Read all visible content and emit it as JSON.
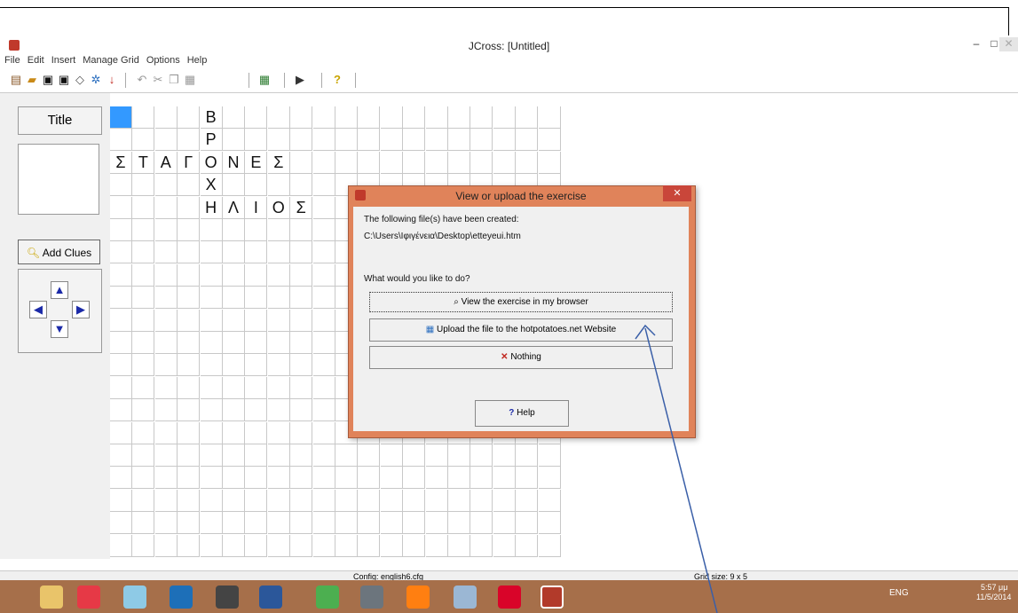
{
  "window": {
    "title": "JCross: [Untitled]",
    "minimize": "–",
    "maximize": "□",
    "close": "✕"
  },
  "menu": [
    "File",
    "Edit",
    "Insert",
    "Manage Grid",
    "Options",
    "Help"
  ],
  "toolbar_icons": [
    "new-icon",
    "open-icon",
    "save-icon",
    "save-as-icon",
    "eraser-icon",
    "web-page-icon",
    "down-arrow-icon",
    "undo-icon",
    "cut-icon",
    "copy-icon",
    "paste-icon",
    "grid-icon",
    "exercise-icon",
    "help-icon"
  ],
  "left_panel": {
    "title_button": "Title",
    "add_clues_button": "Add Clues"
  },
  "grid": {
    "rows": [
      [
        "",
        "",
        "",
        "",
        "Β"
      ],
      [
        "",
        "",
        "",
        "",
        "Ρ"
      ],
      [
        "Σ",
        "Τ",
        "Α",
        "Γ",
        "Ο",
        "Ν",
        "Ε",
        "Σ"
      ],
      [
        "",
        "",
        "",
        "",
        "Χ"
      ],
      [
        "",
        "",
        "",
        "",
        "Η",
        "Λ",
        "Ι",
        "Ο",
        "Σ"
      ]
    ],
    "selected_color": "#3399ff"
  },
  "dialog": {
    "title": "View or upload the exercise",
    "line1": "The following file(s) have been created:",
    "line2": "C:\\Users\\Ιφιγένεια\\Desktop\\etteyeui.htm",
    "question": "What would you like to do?",
    "view_button": "View the exercise in my browser",
    "upload_button": "Upload the file to the hotpotatoes.net Website",
    "nothing_button": "Nothing",
    "help_button": "Help"
  },
  "status": {
    "config": "Config: english6.cfg",
    "grid_size": "Grid size: 9 x 5"
  },
  "tray": {
    "lang": "ENG",
    "time": "5:57 μμ",
    "date": "11/5/2014"
  }
}
